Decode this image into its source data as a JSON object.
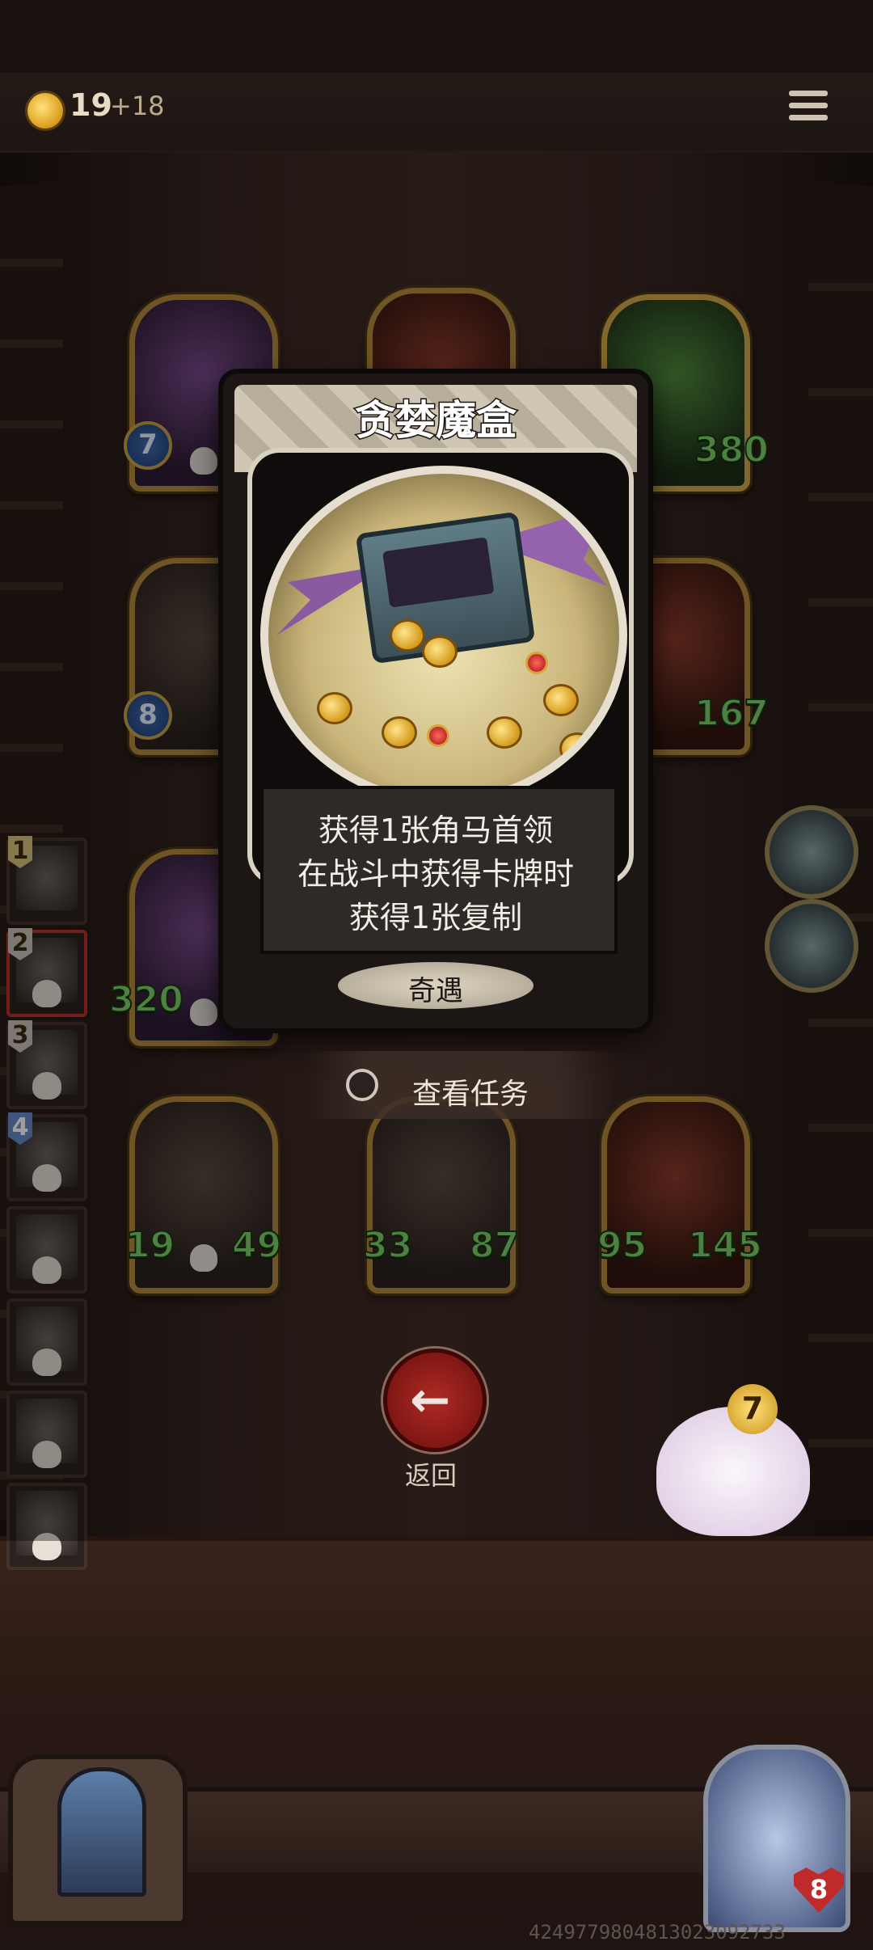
{
  "top_bar": {
    "gold": "19",
    "gold_income": "+18",
    "menu_icon": "hamburger-menu-icon"
  },
  "opponents": [
    {
      "stat": "7",
      "stat_style": "badge"
    },
    {
      "stat": ""
    },
    {
      "stat": "380"
    },
    {
      "stat": "8",
      "stat_style": "badge"
    },
    {
      "stat": "167"
    },
    {
      "stat": "320"
    },
    {
      "stat_left": "19",
      "stat_right": "49"
    },
    {
      "stat_left": "33",
      "stat_right": "87"
    },
    {
      "stat_left": "95",
      "stat_right": "145"
    }
  ],
  "deck": [
    "1",
    "2",
    "3",
    "4",
    "",
    "",
    "",
    ""
  ],
  "event_card": {
    "title": "贪婪魔盒",
    "desc_line1": "获得1张角马首领",
    "desc_line2": "在战斗中获得卡牌时",
    "desc_line3": "获得1张复制",
    "type": "奇遇"
  },
  "view_tasks": {
    "label": "查看任务"
  },
  "back_button": {
    "label": "返回",
    "icon": "left-arrow-icon"
  },
  "mascot": {
    "badge": "7"
  },
  "player": {
    "hp": "8"
  },
  "build_id": "4249779804813023092733"
}
